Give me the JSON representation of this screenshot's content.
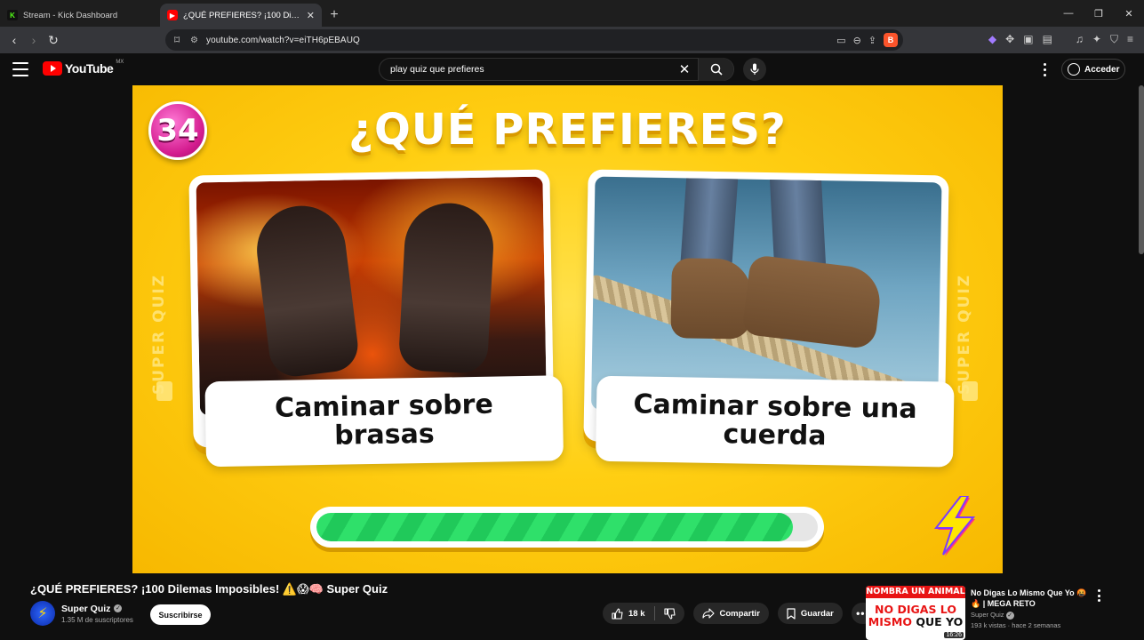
{
  "browser": {
    "tabs": [
      {
        "title": "Stream - Kick Dashboard",
        "favicon": "kick-icon",
        "active": false
      },
      {
        "title": "¿QUÉ PREFIERES? ¡100 Dilemas I",
        "favicon": "youtube-icon",
        "active": true
      }
    ],
    "url": "youtube.com/watch?v=eiTH6pEBAUQ"
  },
  "youtube": {
    "logo_text": "YouTube",
    "region": "MX",
    "search_query": "play quiz que prefieres",
    "sign_in": "Acceder"
  },
  "video": {
    "question_number": "34",
    "heading": "¿QUÉ PREFIERES?",
    "brand_vertical": "SUPER QUIZ",
    "option_left": "Caminar sobre brasas",
    "option_right": "Caminar sobre una cuerda",
    "timer_progress": 0.95,
    "colors": {
      "background": "#ffcf13",
      "badge": "#d41c8f",
      "progress": "#2fe06a"
    }
  },
  "info": {
    "title": "¿QUÉ PREFIERES? ¡100 Dilemas Imposibles! ⚠️😱🧠 Super Quiz",
    "channel_name": "Super Quiz",
    "subscribers": "1.35 M de suscriptores",
    "subscribe_label": "Suscribirse",
    "likes": "18 k",
    "share_label": "Compartir",
    "save_label": "Guardar"
  },
  "recommended": {
    "thumb_band": "NOMBRA UN ANIMAL",
    "thumb_line1": "NO DIGAS LO",
    "thumb_line2a": "MISMO",
    "thumb_line2b": "QUE YO",
    "duration": "16:26",
    "title": "No Digas Lo Mismo Que Yo 🤬🔥 | MEGA RETO",
    "channel": "Super Quiz",
    "stats": "193 k vistas · hace 2 semanas"
  }
}
